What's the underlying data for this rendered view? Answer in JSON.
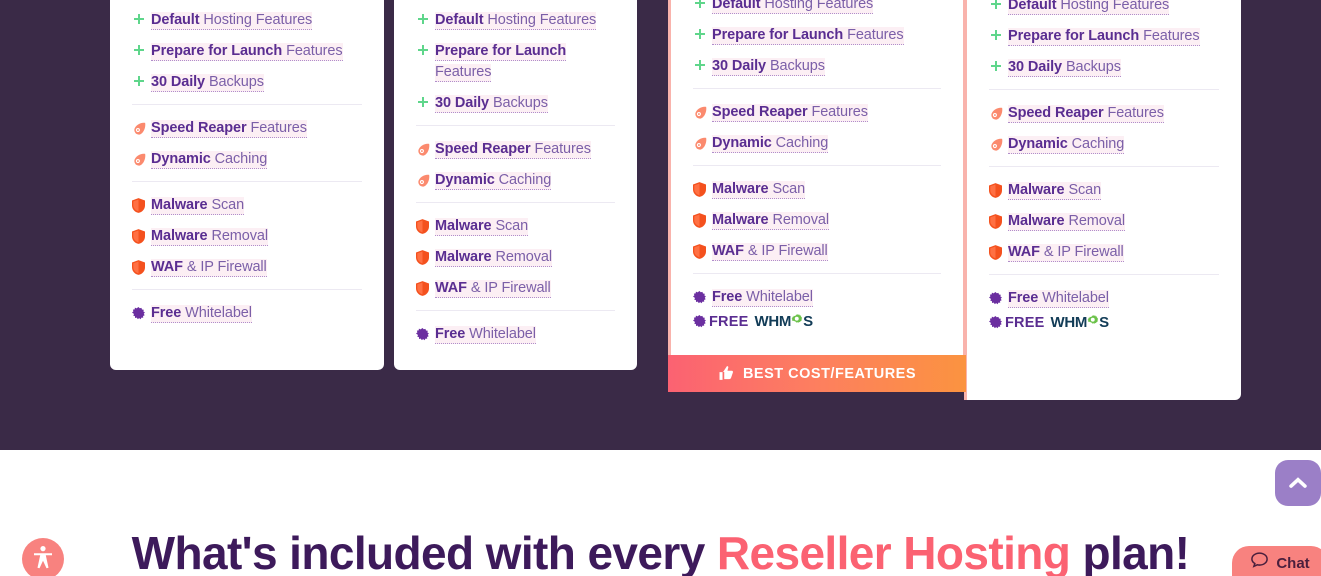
{
  "theme": {
    "page_background": "#3a2a47",
    "card_background": "#ffffff",
    "featured_border": "#f9b3ac",
    "accent_coral": "#fb6272",
    "accent_orange": "#fb9340",
    "heading_purple": "#3d1a5b",
    "bold_purple": "#5a2d91",
    "light_purple": "#7b5fa8",
    "highlight_pink": "#fceff4",
    "scroll_top_purple": "#9b7fc7",
    "widget_salmon": "#f8827f"
  },
  "plans": [
    {
      "id": "plan-1",
      "features": [
        {
          "icon": "plus-icon",
          "bold": "Default",
          "rest": " Hosting Features",
          "group": "a"
        },
        {
          "icon": "plus-icon",
          "bold": "Prepare for Launch",
          "rest": " Features",
          "group": "a"
        },
        {
          "icon": "plus-icon",
          "bold": "30 Daily",
          "rest": " Backups",
          "group": "a"
        },
        {
          "icon": "comet-icon",
          "bold": "Speed Reaper",
          "rest": " Features",
          "group": "b"
        },
        {
          "icon": "comet-icon",
          "bold": "Dynamic",
          "rest": " Caching",
          "group": "b"
        },
        {
          "icon": "shield-icon",
          "bold": "Malware",
          "rest": " Scan",
          "group": "c"
        },
        {
          "icon": "shield-icon",
          "bold": "Malware",
          "rest": " Removal",
          "group": "c"
        },
        {
          "icon": "shield-icon",
          "bold": "WAF",
          "rest": " & IP Firewall",
          "group": "c"
        },
        {
          "icon": "starburst-icon",
          "bold": "Free",
          "rest": " Whitelabel",
          "group": "d"
        }
      ],
      "whmcs": null,
      "badge": null
    },
    {
      "id": "plan-2",
      "features": [
        {
          "icon": "plus-icon",
          "bold": "Default",
          "rest": " Hosting Features",
          "group": "a"
        },
        {
          "icon": "plus-icon",
          "bold": "Prepare for Launch",
          "rest": " Features",
          "group": "a"
        },
        {
          "icon": "plus-icon",
          "bold": "30 Daily",
          "rest": " Backups",
          "group": "a"
        },
        {
          "icon": "comet-icon",
          "bold": "Speed Reaper",
          "rest": " Features",
          "group": "b"
        },
        {
          "icon": "comet-icon",
          "bold": "Dynamic",
          "rest": " Caching",
          "group": "b"
        },
        {
          "icon": "shield-icon",
          "bold": "Malware",
          "rest": " Scan",
          "group": "c"
        },
        {
          "icon": "shield-icon",
          "bold": "Malware",
          "rest": " Removal",
          "group": "c"
        },
        {
          "icon": "shield-icon",
          "bold": "WAF",
          "rest": " & IP Firewall",
          "group": "c"
        },
        {
          "icon": "starburst-icon",
          "bold": "Free",
          "rest": " Whitelabel",
          "group": "d"
        }
      ],
      "whmcs": null,
      "badge": null
    },
    {
      "id": "plan-3",
      "features": [
        {
          "icon": "plus-icon",
          "bold": "Default",
          "rest": " Hosting Features",
          "group": "a"
        },
        {
          "icon": "plus-icon",
          "bold": "Prepare for Launch",
          "rest": " Features",
          "group": "a"
        },
        {
          "icon": "plus-icon",
          "bold": "30 Daily",
          "rest": " Backups",
          "group": "a"
        },
        {
          "icon": "comet-icon",
          "bold": "Speed Reaper",
          "rest": " Features",
          "group": "b"
        },
        {
          "icon": "comet-icon",
          "bold": "Dynamic",
          "rest": " Caching",
          "group": "b"
        },
        {
          "icon": "shield-icon",
          "bold": "Malware",
          "rest": " Scan",
          "group": "c"
        },
        {
          "icon": "shield-icon",
          "bold": "Malware",
          "rest": " Removal",
          "group": "c"
        },
        {
          "icon": "shield-icon",
          "bold": "WAF",
          "rest": " & IP Firewall",
          "group": "c"
        },
        {
          "icon": "starburst-icon",
          "bold": "Free",
          "rest": " Whitelabel",
          "group": "d"
        }
      ],
      "whmcs": {
        "icon": "starburst-icon",
        "free_label": "FREE",
        "logo_text": "WHMCS"
      },
      "badge": {
        "icon": "thumbs-up-icon",
        "label": "BEST COST/FEATURES"
      }
    },
    {
      "id": "plan-4",
      "features": [
        {
          "icon": "plus-icon",
          "bold": "Default",
          "rest": " Hosting Features",
          "group": "a"
        },
        {
          "icon": "plus-icon",
          "bold": "Prepare for Launch",
          "rest": " Features",
          "group": "a"
        },
        {
          "icon": "plus-icon",
          "bold": "30 Daily",
          "rest": " Backups",
          "group": "a"
        },
        {
          "icon": "comet-icon",
          "bold": "Speed Reaper",
          "rest": " Features",
          "group": "b"
        },
        {
          "icon": "comet-icon",
          "bold": "Dynamic",
          "rest": " Caching",
          "group": "b"
        },
        {
          "icon": "shield-icon",
          "bold": "Malware",
          "rest": " Scan",
          "group": "c"
        },
        {
          "icon": "shield-icon",
          "bold": "Malware",
          "rest": " Removal",
          "group": "c"
        },
        {
          "icon": "shield-icon",
          "bold": "WAF",
          "rest": " & IP Firewall",
          "group": "c"
        },
        {
          "icon": "starburst-icon",
          "bold": "Free",
          "rest": " Whitelabel",
          "group": "d"
        }
      ],
      "whmcs": {
        "icon": "starburst-icon",
        "free_label": "FREE",
        "logo_text": "WHMCS"
      },
      "badge": null
    }
  ],
  "lower_section": {
    "heading_part1": "What's included with ",
    "heading_accent": "every Reseller Hosting",
    "heading_part2": " plan!",
    "heading_lead": "What's included with ",
    "heading_mid_plain": "every ",
    "heading_mid_accent": "Reseller Hosting",
    "heading_tail": " plan!"
  },
  "widgets": {
    "scroll_top": {
      "icon": "chevron-up-icon",
      "label": ""
    },
    "accessibility": {
      "icon": "accessibility-icon",
      "label": ""
    },
    "chat": {
      "icon": "chat-bubble-icon",
      "label": "Chat"
    }
  }
}
